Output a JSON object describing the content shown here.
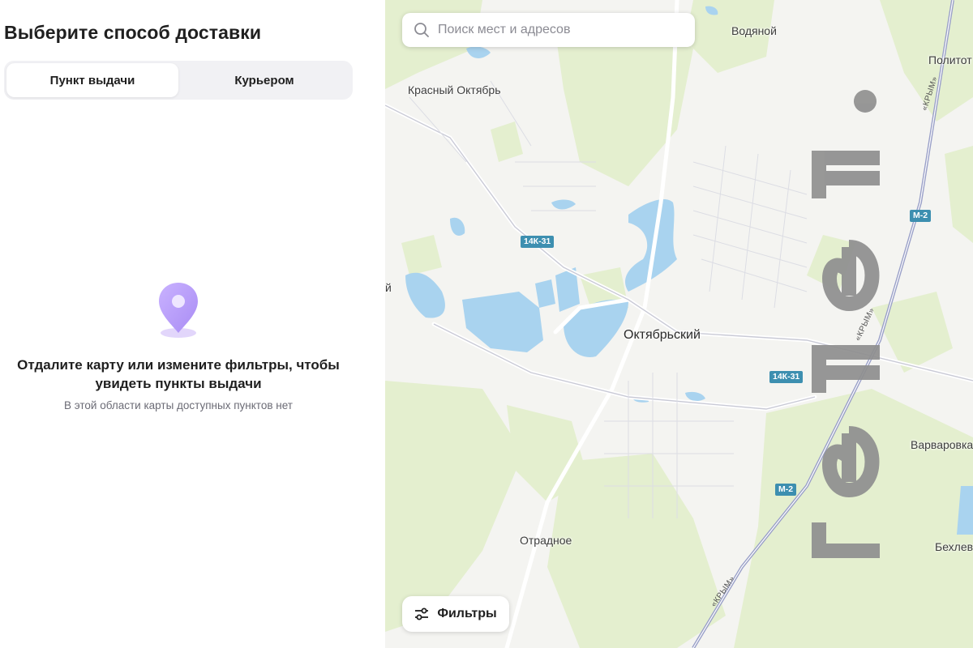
{
  "panel": {
    "title": "Выберите способ доставки",
    "tabs": [
      {
        "label": "Пункт выдачи",
        "active": true
      },
      {
        "label": "Курьером",
        "active": false
      }
    ],
    "empty_state": {
      "icon": "location-pin-icon",
      "title": "Отдалите карту или измените фильтры, чтобы увидеть пункты выдачи",
      "subtitle": "В этой области карты доступных пунктов нет"
    }
  },
  "map": {
    "search": {
      "placeholder": "Поиск мест и адресов",
      "value": "",
      "icon": "search-icon"
    },
    "filters_button": {
      "label": "Фильтры",
      "icon": "sliders-icon"
    },
    "places": {
      "vodyanoy": "Водяной",
      "krasny_oktyabr": "Красный Октябрь",
      "oktyabrsky": "Октябрьский",
      "otradnoe": "Отрадное",
      "varvarovka": "Варваровка",
      "politot": "Политот",
      "bekhlev": "Бехлев",
      "left_edge": "й"
    },
    "road_shields": {
      "k31_a": "14К-31",
      "k31_b": "14К-31",
      "m2_a": "М-2",
      "m2_b": "М-2"
    },
    "road_names": {
      "krym_a": "«КРЫМ»",
      "krym_b": "«КРЫМ»",
      "krym_c": "«КРЫМ»"
    },
    "colors": {
      "land": "#f4f4f1",
      "vegetation": "#e4efcf",
      "water": "#a9d3ef",
      "road_shield": "#3d8fb0"
    }
  },
  "watermark": {
    "text": "nenel"
  }
}
